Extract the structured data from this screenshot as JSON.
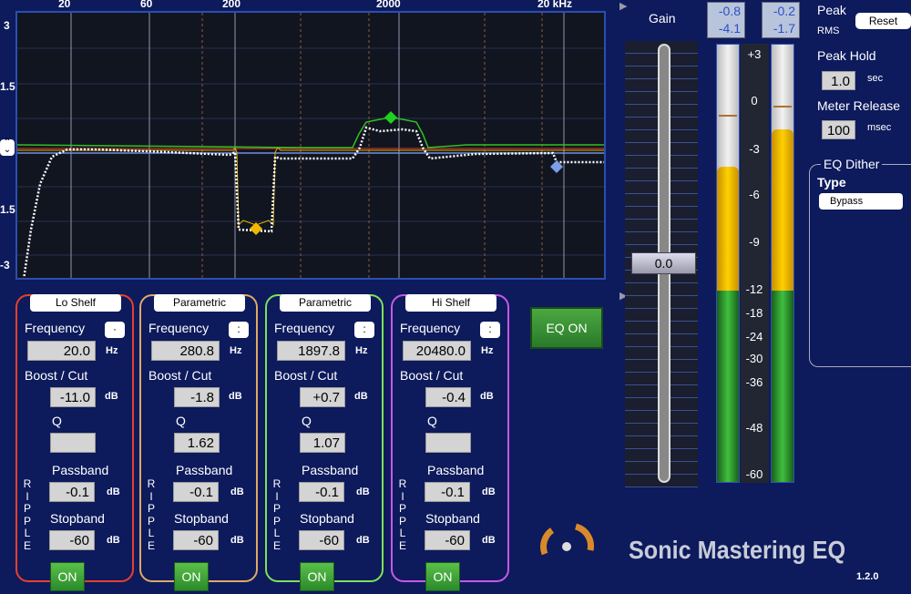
{
  "graph": {
    "freq_labels": [
      "20",
      "60",
      "200",
      "2000",
      "20 kHz"
    ],
    "db_labels": [
      "3",
      "1.5",
      "1.5",
      "-3"
    ],
    "curve_colors": {
      "response": "#ffffff",
      "lo_shelf": "#e03a2a",
      "parametric1": "#e0b000",
      "parametric2": "#30c020",
      "hi_shelf": "#7090e0"
    }
  },
  "bands": [
    {
      "type": "Lo Shelf",
      "color": "#e8402c",
      "frequency_label": "Frequency",
      "frequency": "20.0",
      "freq_unit": "Hz",
      "freq_select": "·",
      "boost_label": "Boost / Cut",
      "boost": "-11.0",
      "boost_unit": "dB",
      "q_label": "Q",
      "q": "",
      "ripple_label": "RIPPLE",
      "passband_label": "Passband",
      "passband": "-0.1",
      "passband_unit": "dB",
      "stopband_label": "Stopband",
      "stopband": "-60",
      "stopband_unit": "dB",
      "on": "ON"
    },
    {
      "type": "Parametric",
      "color": "#e0a868",
      "frequency_label": "Frequency",
      "frequency": "280.8",
      "freq_unit": "Hz",
      "freq_select": ":",
      "boost_label": "Boost / Cut",
      "boost": "-1.8",
      "boost_unit": "dB",
      "q_label": "Q",
      "q": "1.62",
      "ripple_label": "RIPPLE",
      "passband_label": "Passband",
      "passband": "-0.1",
      "passband_unit": "dB",
      "stopband_label": "Stopband",
      "stopband": "-60",
      "stopband_unit": "dB",
      "on": "ON"
    },
    {
      "type": "Parametric",
      "color": "#7ee05a",
      "frequency_label": "Frequency",
      "frequency": "1897.8",
      "freq_unit": "Hz",
      "freq_select": ":",
      "boost_label": "Boost / Cut",
      "boost": "+0.7",
      "boost_unit": "dB",
      "q_label": "Q",
      "q": "1.07",
      "ripple_label": "RIPPLE",
      "passband_label": "Passband",
      "passband": "-0.1",
      "passband_unit": "dB",
      "stopband_label": "Stopband",
      "stopband": "-60",
      "stopband_unit": "dB",
      "on": "ON"
    },
    {
      "type": "Hi Shelf",
      "color": "#c858e8",
      "frequency_label": "Frequency",
      "frequency": "20480.0",
      "freq_unit": "Hz",
      "freq_select": ":",
      "boost_label": "Boost / Cut",
      "boost": "-0.4",
      "boost_unit": "dB",
      "q_label": "Q",
      "q": "",
      "ripple_label": "RIPPLE",
      "passband_label": "Passband",
      "passband": "-0.1",
      "passband_unit": "dB",
      "stopband_label": "Stopband",
      "stopband": "-60",
      "stopband_unit": "dB",
      "on": "ON"
    }
  ],
  "eq_on": "EQ ON",
  "gain": {
    "label": "Gain",
    "value": "0.0"
  },
  "meters": {
    "left": {
      "peak": "-0.8",
      "rms": "-4.1",
      "level_db": -4.1,
      "peak_hold_db": -0.8
    },
    "right": {
      "peak": "-0.2",
      "rms": "-1.7",
      "level_db": -1.7,
      "peak_hold_db": -0.2
    },
    "scale": [
      "+3",
      "0",
      "-3",
      "-6",
      "-9",
      "-12",
      "-18",
      "-24",
      "-30",
      "-36",
      "-48",
      "-60"
    ]
  },
  "settings": {
    "peak_label": "Peak",
    "rms_label": "RMS",
    "reset": "Reset",
    "peak_hold_label": "Peak Hold",
    "peak_hold": "1.0",
    "peak_hold_unit": "sec",
    "meter_release_label": "Meter Release",
    "meter_release": "100",
    "meter_release_unit": "msec"
  },
  "dither": {
    "title": "EQ Dither",
    "type_label": "Type",
    "type": "Bypass"
  },
  "brand": {
    "name": "Sonic Mastering EQ",
    "version": "1.2.0"
  }
}
